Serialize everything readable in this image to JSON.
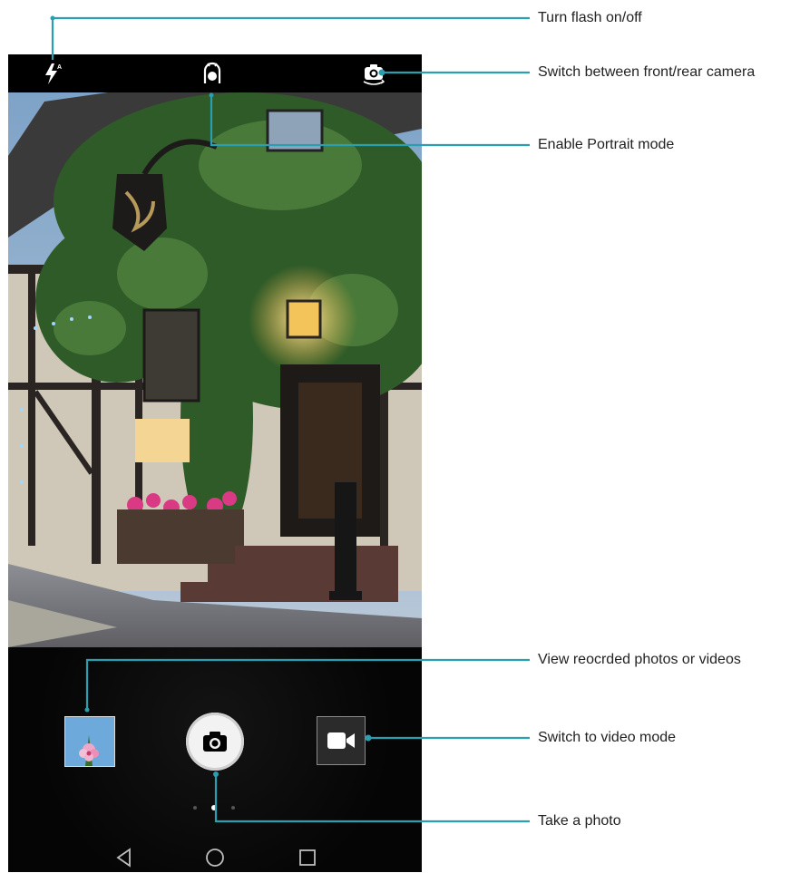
{
  "annotations": {
    "flash": "Turn flash on/off",
    "switch_camera": "Switch between front/rear camera",
    "portrait": "Enable Portrait mode",
    "gallery": "View reocrded photos or videos",
    "video": "Switch to video mode",
    "shutter": "Take a photo"
  },
  "topbar": {
    "flash_icon": "flash-auto-icon",
    "portrait_icon": "portrait-mode-icon",
    "switch_icon": "switch-camera-icon"
  },
  "navbar": {
    "back_icon": "back-triangle-icon",
    "home_icon": "home-circle-icon",
    "recents_icon": "recents-square-icon"
  },
  "mode_dots": {
    "count": 3,
    "active": 1
  },
  "colors": {
    "callout_line": "#2a9fb0",
    "phone_bg": "#000000"
  }
}
